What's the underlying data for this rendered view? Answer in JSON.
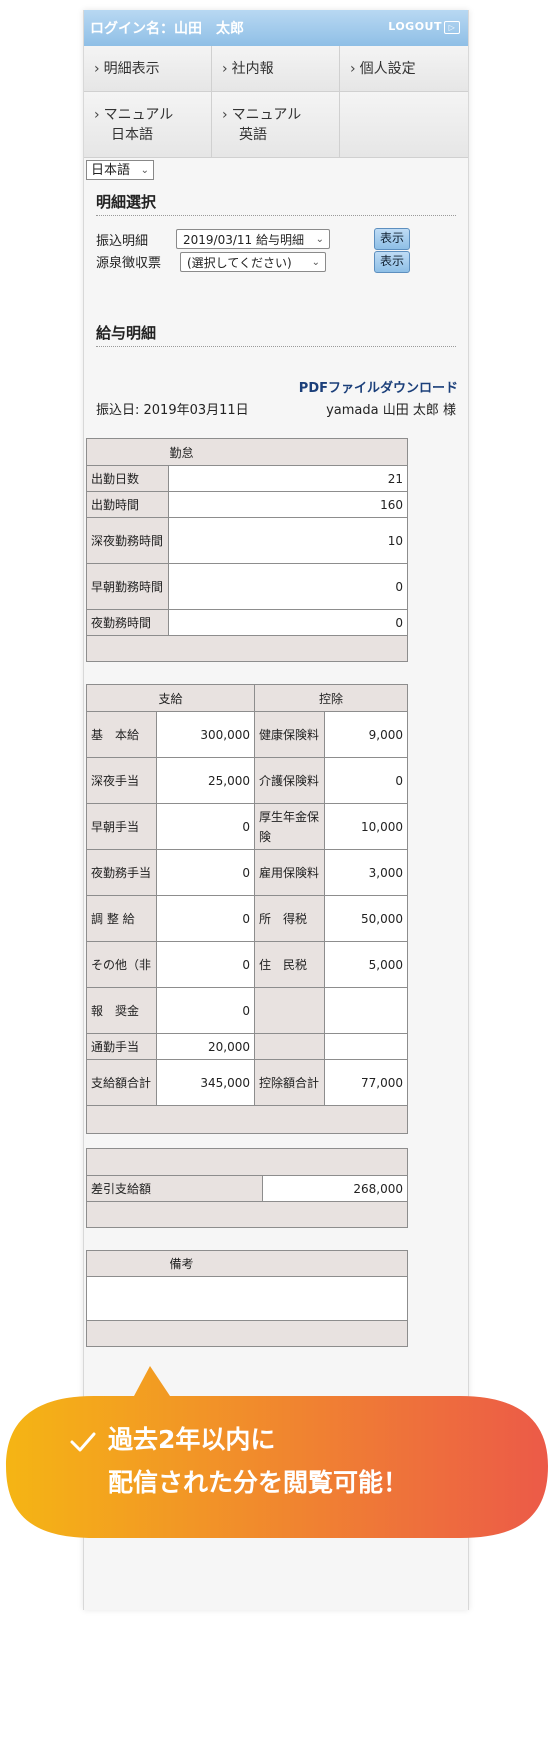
{
  "header": {
    "login": "ログイン名：山田　太郎",
    "logout": "LOGOUT"
  },
  "nav": {
    "row1": [
      "明細表示",
      "社内報",
      "個人設定"
    ],
    "row2": [
      [
        "マニュアル",
        "日本語"
      ],
      [
        "マニュアル",
        "英語"
      ]
    ]
  },
  "language": "日本語",
  "select_section": {
    "title": "明細選択",
    "rows": [
      {
        "label": "振込明細",
        "value": "2019/03/11 給与明細",
        "button": "表示"
      },
      {
        "label": "源泉徴収票",
        "value": "(選択してください)",
        "button": "表示"
      }
    ]
  },
  "detail": {
    "title": "給与明細",
    "pdf_link": "PDFファイルダウンロード",
    "pay_date": "振込日: 2019年03月11日",
    "name": "yamada 山田 太郎 様"
  },
  "attendance": {
    "header": "勤怠",
    "rows": [
      [
        "出勤日数",
        "21"
      ],
      [
        "出勤時間",
        "160"
      ],
      [
        "深夜勤務時間",
        "10"
      ],
      [
        "早朝勤務時間",
        "0"
      ],
      [
        "夜勤務時間",
        "0"
      ]
    ]
  },
  "pay": {
    "header_pay": "支給",
    "header_deduct": "控除",
    "rows": [
      [
        "基　本給",
        "300,000",
        "健康保険料",
        "9,000"
      ],
      [
        "深夜手当",
        "25,000",
        "介護保険料",
        "0"
      ],
      [
        "早朝手当",
        "0",
        "厚生年金保険",
        "10,000"
      ],
      [
        "夜勤務手当",
        "0",
        "雇用保険料",
        "3,000"
      ],
      [
        "調 整 給",
        "0",
        "所　得税",
        "50,000"
      ],
      [
        "その他（非",
        "0",
        "住　民税",
        "5,000"
      ],
      [
        "報　奨金",
        "0",
        "",
        ""
      ],
      [
        "通勤手当",
        "20,000",
        "",
        ""
      ],
      [
        "支給額合計",
        "345,000",
        "控除額合計",
        "77,000"
      ]
    ]
  },
  "net": {
    "label": "差引支給額",
    "value": "268,000"
  },
  "remarks": {
    "header": "備考"
  },
  "callout": {
    "line1": "過去2年以内に",
    "line2": "配信された分を閲覧可能！",
    "colors": [
      "#f5b514",
      "#ec5a48"
    ]
  }
}
